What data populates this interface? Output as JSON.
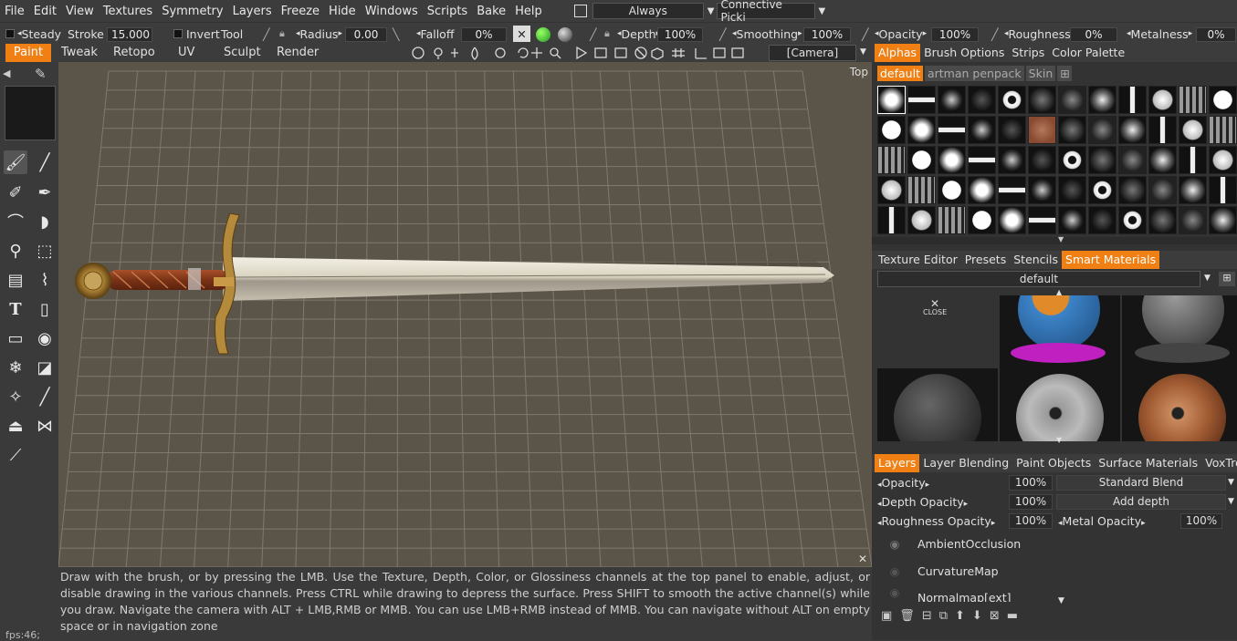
{
  "menu": [
    "File",
    "Edit",
    "View",
    "Textures",
    "Symmetry",
    "Layers",
    "Freeze",
    "Hide",
    "Windows",
    "Scripts",
    "Bake",
    "Help"
  ],
  "menu_right": {
    "always_label": "Always",
    "picking_label": "Connective Picki"
  },
  "toolbar": {
    "steady_label": "Steady",
    "stroke_label": "Stroke",
    "stroke_value": "15.000",
    "invert_label": "Invert",
    "tool_label": "Tool",
    "radius_label": "Radius",
    "radius_value": "0.00",
    "falloff_label": "Falloff",
    "falloff_value": "0%",
    "depth_label": "Depth",
    "depth_value": "100%",
    "smoothing_label": "Smoothing",
    "smoothing_value": "100%",
    "opacity_label": "Opacity",
    "opacity_value": "100%",
    "roughness_label": "Roughness",
    "roughness_value": "0%",
    "metalness_label": "Metalness",
    "metalness_value": "0%"
  },
  "modes": [
    "Paint",
    "Tweak",
    "Retopo",
    "UV",
    "Sculpt",
    "Render"
  ],
  "camera_label": "[Camera]",
  "view_label": "Top",
  "hint": "Draw with the brush, or by pressing the LMB. Use the Texture, Depth, Color, or Glossiness channels at the top panel to enable, adjust, or disable drawing in the various channels. Press CTRL while drawing to depress the surface. Press SHIFT to smooth the active channel(s) while you draw. Navigate the camera with ALT + LMB,RMB or MMB. You can use LMB+RMB instead of MMB. You can navigate without ALT on empty space or in navigation zone",
  "fps": "fps:46;",
  "panel": {
    "top_tabs": [
      "Alphas",
      "Brush Options",
      "Strips",
      "Color Palette"
    ],
    "alpha_sets": [
      "default",
      "artman penpack",
      "Skin"
    ],
    "mid_tabs": [
      "Texture Editor",
      "Presets",
      "Stencils",
      "Smart Materials"
    ],
    "materials_folder": "default",
    "close_label": "CLOSE",
    "layer_tabs": [
      "Layers",
      "Layer Blending",
      "Paint Objects",
      "Surface Materials",
      "VoxTree"
    ],
    "opacity_label": "Opacity",
    "opacity_value": "100%",
    "blend_label": "Standard Blend",
    "depth_opacity_label": "Depth Opacity",
    "depth_opacity_value": "100%",
    "depth_mode": "Add depth",
    "rough_opacity_label": "Roughness Opacity",
    "rough_opacity_value": "100%",
    "metal_opacity_label": "Metal Opacity",
    "metal_opacity_value": "100%",
    "layers": [
      "AmbientOcclusion",
      "CurvatureMap",
      "Normalmap[ext]"
    ]
  },
  "colors": {
    "accent": "#f07f14",
    "viewport": "#5b5448"
  }
}
